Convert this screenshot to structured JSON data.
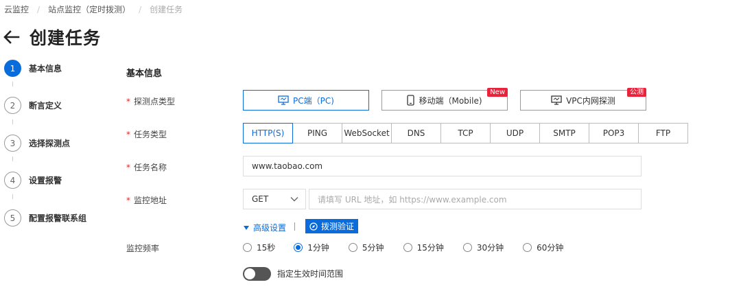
{
  "breadcrumb": {
    "items": [
      "云监控",
      "站点监控（定时拨测）",
      "创建任务"
    ],
    "separator": "/"
  },
  "header": {
    "title": "创建任务",
    "back_icon": "arrow-left-icon"
  },
  "steps": [
    {
      "num": "1",
      "label": "基本信息",
      "active": true
    },
    {
      "num": "2",
      "label": "断言定义",
      "active": false
    },
    {
      "num": "3",
      "label": "选择探测点",
      "active": false
    },
    {
      "num": "4",
      "label": "设置报警",
      "active": false
    },
    {
      "num": "5",
      "label": "配置报警联系组",
      "active": false
    }
  ],
  "form": {
    "section_title": "基本信息",
    "required_mark": "*",
    "probe_type": {
      "label": "探测点类型",
      "options": [
        {
          "label": "PC端（PC)",
          "icon": "monitor-icon",
          "selected": true,
          "badge": ""
        },
        {
          "label": "移动端（Mobile)",
          "icon": "mobile-icon",
          "selected": false,
          "badge": "New"
        },
        {
          "label": "VPC内网探测",
          "icon": "monitor-icon",
          "selected": false,
          "badge": "公测"
        }
      ]
    },
    "task_type": {
      "label": "任务类型",
      "options": [
        "HTTP(S)",
        "PING",
        "WebSocket",
        "DNS",
        "TCP",
        "UDP",
        "SMTP",
        "POP3",
        "FTP"
      ],
      "selected": "HTTP(S)"
    },
    "task_name": {
      "label": "任务名称",
      "value": "www.taobao.com"
    },
    "monitor_url": {
      "label": "监控地址",
      "method": "GET",
      "placeholder": "请填写 URL 地址，如 https://www.example.com"
    },
    "advanced": {
      "label": "高级设置",
      "probe_button": "拨测验证"
    },
    "frequency": {
      "label": "监控频率",
      "options": [
        "15秒",
        "1分钟",
        "5分钟",
        "15分钟",
        "30分钟",
        "60分钟"
      ],
      "selected": "1分钟"
    },
    "time_range": {
      "label": "指定生效时间范围",
      "enabled": false
    }
  },
  "colors": {
    "accent": "#0a6cdb",
    "badge": "#e8243c",
    "required": "#e12525"
  }
}
